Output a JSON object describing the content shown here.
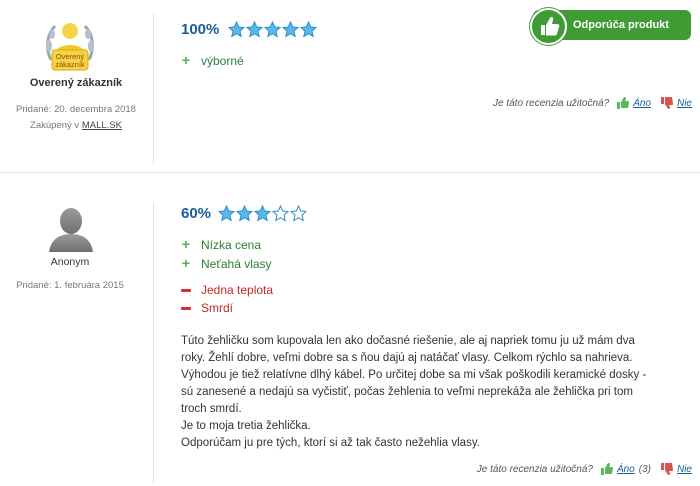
{
  "reviews": [
    {
      "author": "Overený zákazník",
      "badge_text_1": "Overený",
      "badge_text_2": "zákazník",
      "added": "Pridané: 20. decembra 2018",
      "purchased_prefix": "Zakúpený v",
      "purchased_store": "MALL.SK",
      "score": "100%",
      "stars": 5,
      "recommend_label": "Odporúča produkt",
      "pros": [
        "výborné"
      ],
      "cons": [],
      "text": [],
      "helpful_question": "Je táto recenzia užitočná?",
      "yes_label": "Áno",
      "yes_count": "",
      "no_label": "Nie"
    },
    {
      "author": "Anonym",
      "added": "Pridané: 1. februára 2015",
      "score": "60%",
      "stars": 3,
      "pros": [
        "Nízka cena",
        "Neťahá vlasy"
      ],
      "cons": [
        "Jedna teplota",
        "Smrdí"
      ],
      "text": [
        "Túto žehličku som kupovala len ako dočasné riešenie, ale aj napriek tomu ju už mám dva",
        "roky. Žehlí dobre, veľmi dobre sa s ňou dajú aj natáčať vlasy. Celkom rýchlo sa nahrieva.",
        "Výhodou je tiež relatívne dlhý kábel. Po určitej dobe sa mi však poškodili keramické dosky -",
        "sú zanesené a nedajú sa vyčistiť, počas žehlenia to veľmi neprekáža ale žehlička pri tom",
        "troch smrdí.",
        "Je to moja tretia žehlička.",
        "Odporúčam ju pre tých, ktorí si až tak často nežehlia vlasy."
      ],
      "helpful_question": "Je táto recenzia užitočná?",
      "yes_label": "Áno",
      "yes_count": "(3)",
      "no_label": "Nie"
    }
  ],
  "colors": {
    "star_fill": "#5bb8e8",
    "star_stroke": "#2a8fcf",
    "pro": "#2e7d32",
    "con": "#c62828",
    "recommend_bg": "#3f9c35",
    "score": "#1a5c99"
  },
  "icons": {
    "verified": "verified-customer-badge-icon",
    "anonymous": "anonymous-avatar-icon",
    "recommend": "thumbs-up-icon",
    "yes": "thumbs-up-icon",
    "no": "thumbs-down-icon"
  }
}
